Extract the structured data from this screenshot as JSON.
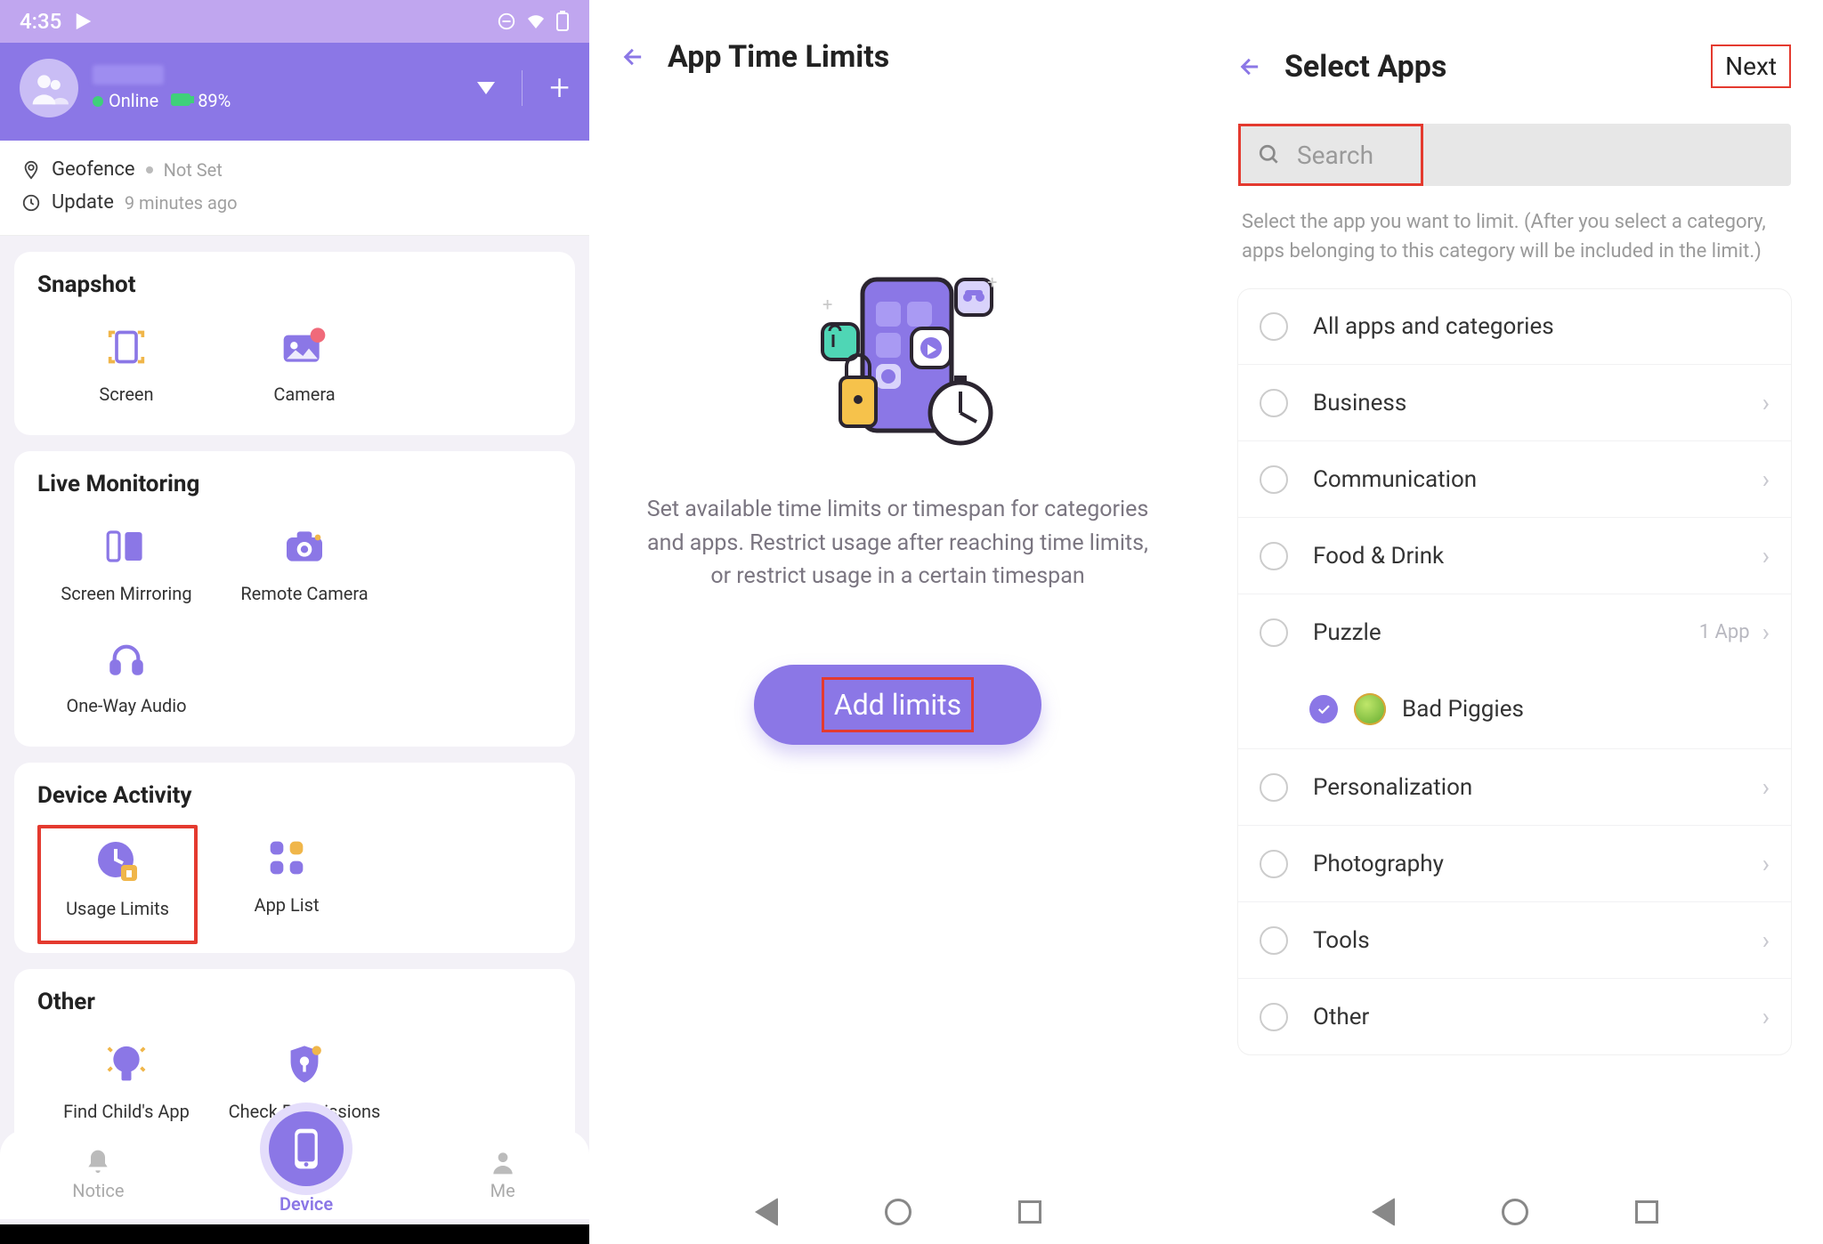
{
  "panel1": {
    "status": {
      "time": "4:35"
    },
    "header": {
      "online_label": "Online",
      "battery": "89%"
    },
    "info": {
      "geofence_label": "Geofence",
      "geofence_value": "Not Set",
      "update_label": "Update",
      "update_value": "9 minutes ago"
    },
    "sections": {
      "snapshot": {
        "title": "Snapshot",
        "items": [
          {
            "label": "Screen"
          },
          {
            "label": "Camera"
          }
        ]
      },
      "live": {
        "title": "Live Monitoring",
        "items": [
          {
            "label": "Screen Mirroring"
          },
          {
            "label": "Remote Camera"
          },
          {
            "label": "One-Way Audio"
          }
        ]
      },
      "activity": {
        "title": "Device Activity",
        "items": [
          {
            "label": "Usage Limits"
          },
          {
            "label": "App List"
          }
        ]
      },
      "other": {
        "title": "Other",
        "items": [
          {
            "label": "Find Child's App"
          },
          {
            "label": "Check Permissions"
          }
        ]
      }
    },
    "nav": {
      "notice": "Notice",
      "device": "Device",
      "me": "Me"
    }
  },
  "panel2": {
    "title": "App Time Limits",
    "description": "Set available time limits or timespan for categories and apps. Restrict usage after reaching time limits, or restrict usage in a certain timespan",
    "button": "Add limits"
  },
  "panel3": {
    "title": "Select Apps",
    "next": "Next",
    "search_placeholder": "Search",
    "hint": "Select the app you want to limit. (After you select a category, apps belonging to this category will be included in the limit.)",
    "rows": {
      "all": "All apps and categories",
      "business": "Business",
      "communication": "Communication",
      "food": "Food & Drink",
      "puzzle": "Puzzle",
      "puzzle_meta": "1 App",
      "bad_piggies": "Bad Piggies",
      "personalization": "Personalization",
      "photography": "Photography",
      "tools": "Tools",
      "other": "Other"
    }
  }
}
